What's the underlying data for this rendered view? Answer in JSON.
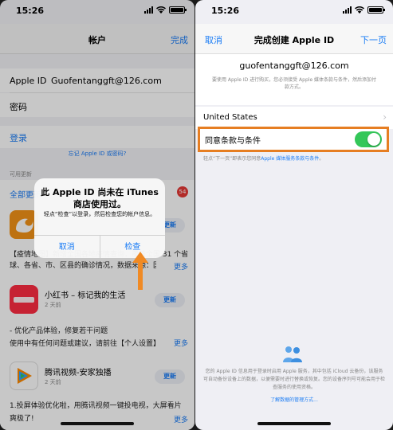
{
  "status_time": "15:26",
  "left": {
    "nav_title": "帐户",
    "nav_done": "完成",
    "apple_id_label": "Apple ID",
    "apple_id_value": "Guofentanggft@126.com",
    "password_label": "密码",
    "login_label": "登录",
    "forgot_link": "忘记 Apple ID 或密码?",
    "available_updates_label": "可用更新",
    "update_all_label": "全部更新",
    "updates_count": "54",
    "apps": [
      {
        "name": "",
        "age": "",
        "update_label": "更新",
        "note": "【疫情地图】新增全国各地疫情查询，覆盖全国 31 个省、区、市，涵盖",
        "note2": "球、各省、市、区县的确诊情况，数据来源：国家、",
        "more_label": "更多"
      },
      {
        "name": "小红书 – 标记我的生活",
        "age": "2 天前",
        "update_label": "更新",
        "note": "- 优化产品体验，修复若干问题",
        "note2": "使用中有任何问题或建议，请前往【个人设置】",
        "more_label": "更多"
      },
      {
        "name": "腾讯视频-安家独播",
        "age": "2 天前",
        "update_label": "更新",
        "note": "1.投屏体验优化啦，用腾讯视频一键投电视，大屏看片",
        "note2": "爽极了!",
        "more_label": "更多"
      }
    ],
    "alert": {
      "title": "此 Apple ID 尚未在 iTunes 商店使用过。",
      "message": "轻点“检查”以登录，然后检查您的帐户信息。",
      "cancel_label": "取消",
      "review_label": "检查"
    }
  },
  "right": {
    "nav_cancel": "取消",
    "nav_title": "完成创建 Apple ID",
    "nav_next": "下一页",
    "email": "guofentanggft@126.com",
    "email_desc": "要使用 Apple ID 进行购买，您必须接受 Apple 媒体条款与条件，然后添加付款方式。",
    "country": "United States",
    "agree_label": "同意条款与条件",
    "agree_on": true,
    "hint_prefix": "轻点“下一页”即表示您同意",
    "hint_link": "Apple 媒体服务条款与条件",
    "hint_suffix": "。",
    "footer_text": "您的 Apple ID 信息用于登录时启用 Apple 服务，其中包括 iCloud 云备份，该服务可自动备份设备上的数据，以便需要时进行替换或恢复。您的设备序列号可能会用于检查服务的使用资格。",
    "footer_link": "了解数据的管理方式..."
  },
  "colors": {
    "accent": "#1a7cf5",
    "toggle_on": "#34c759",
    "highlight": "#e67e22",
    "badge": "#e53935"
  }
}
